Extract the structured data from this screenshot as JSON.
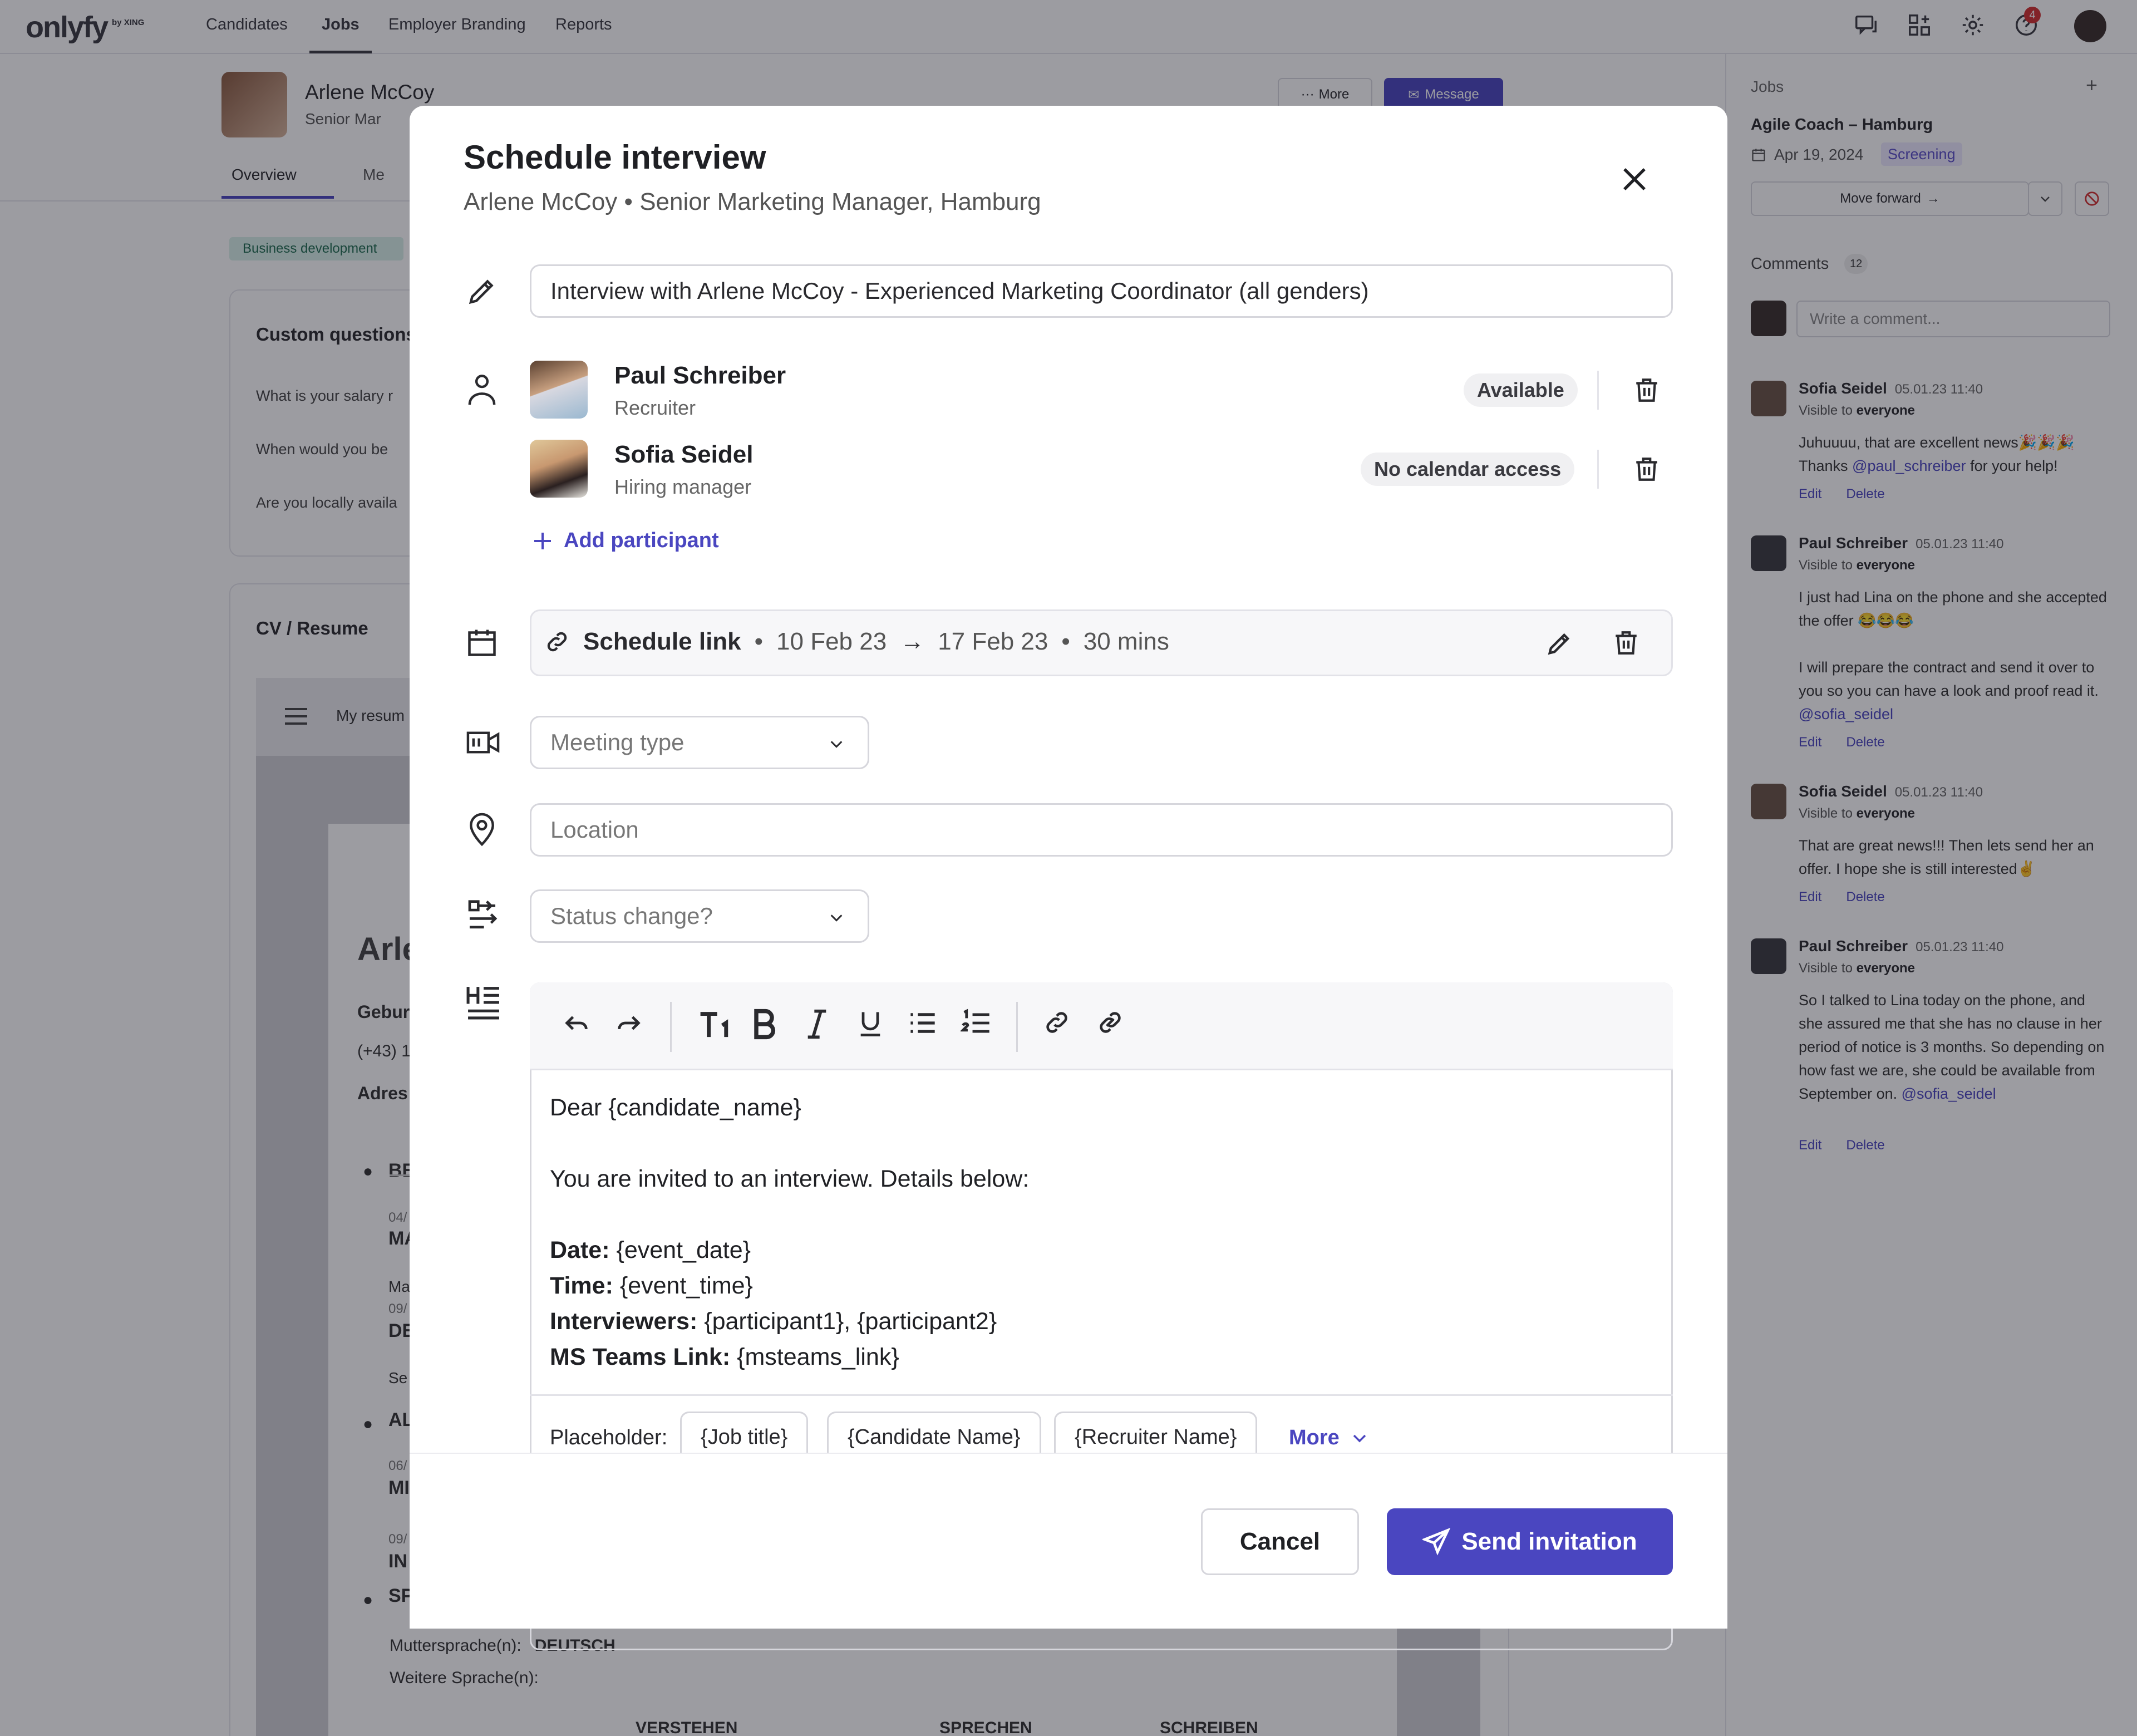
{
  "app": {
    "logo": "onlyfy",
    "logo_suffix": "by XING",
    "nav": [
      "Candidates",
      "Jobs",
      "Employer Branding",
      "Reports"
    ],
    "notifications_count": "4"
  },
  "candidate": {
    "name": "Arlene McCoy",
    "subtitle": "Senior Mar",
    "more_label": "More",
    "message_label": "Message",
    "tabs": [
      "Overview",
      "Me"
    ],
    "tag": "Business development",
    "custom_questions_title": "Custom questions",
    "custom_questions": [
      "What is your salary r",
      "When would you be",
      "Are you locally availa"
    ],
    "cv_title": "CV / Resume",
    "cv_toolbar_label": "My resum",
    "cv_text": {
      "name": "Arle",
      "l1": "Gebur",
      "l2": "(+43) 1",
      "l3": "Adres",
      "b1": "BE",
      "d1": "04/",
      "m1": "MA",
      "m2": "Ma",
      "d2": "09/",
      "de": "DE",
      "se": "Se",
      "al": "AL",
      "d3": "06/",
      "mi": "MI",
      "d4": "09/",
      "in": "IN",
      "sp": "SP",
      "mutter": "Muttersprache(n):",
      "mutter_val": "DEUTSCH",
      "weitere": "Weitere Sprache(n):",
      "cols": [
        "VERSTEHEN",
        "SPRECHEN",
        "SCHREIBEN"
      ]
    }
  },
  "right_panel": {
    "jobs_label": "Jobs",
    "job_title": "Agile Coach – Hamburg",
    "job_date": "Apr 19, 2024",
    "job_status": "Screening",
    "move_forward": "Move forward",
    "comments_label": "Comments",
    "comments_count": "12",
    "write_placeholder": "Write a comment...",
    "comments": [
      {
        "author": "Sofia Seidel",
        "time": "05.01.23 11:40",
        "visible_prefix": "Visible to",
        "visible_to": "everyone",
        "text_a": "Juhuuuu, that are excellent news🎉🎉🎉 Thanks ",
        "mention": "@paul_schreiber",
        "text_b": " for your help!",
        "edit": "Edit",
        "delete": "Delete"
      },
      {
        "author": "Paul Schreiber",
        "time": "05.01.23 11:40",
        "visible_prefix": "Visible to",
        "visible_to": "everyone",
        "text_a": "I just had Lina on the phone and she accepted the offer 😂😂😂\n\nI will prepare the contract and send it over to you so you can have a look and proof read it. ",
        "mention": "@sofia_seidel",
        "text_b": "",
        "edit": "Edit",
        "delete": "Delete"
      },
      {
        "author": "Sofia Seidel",
        "time": "05.01.23 11:40",
        "visible_prefix": "Visible to",
        "visible_to": "everyone",
        "text_a": "That are great news!!! Then lets send her an offer. I hope she is still interested✌️",
        "mention": "",
        "text_b": "",
        "edit": "Edit",
        "delete": "Delete"
      },
      {
        "author": "Paul Schreiber",
        "time": "05.01.23 11:40",
        "visible_prefix": "Visible to",
        "visible_to": "everyone",
        "text_a": "So I talked to Lina today on the phone, and she assured me that she has no clause in her period of notice is 3 months. So depending on how fast we are, she could be available from September on. ",
        "mention": "@sofia_seidel",
        "text_b": "",
        "edit": "Edit",
        "delete": "Delete"
      }
    ]
  },
  "modal": {
    "title": "Schedule interview",
    "subtitle_name": "Arlene McCoy",
    "subtitle_sep": "•",
    "subtitle_job": "Senior Marketing Manager, Hamburg",
    "subject_value": "Interview with Arlene McCoy - Experienced Marketing Coordinator (all genders)",
    "participants": [
      {
        "name": "Paul Schreiber",
        "role": "Recruiter",
        "availability": "Available"
      },
      {
        "name": "Sofia Seidel",
        "role": "Hiring manager",
        "availability": "No calendar access"
      }
    ],
    "add_participant": "Add participant",
    "schedule": {
      "label": "Schedule link",
      "sep": "•",
      "from": "10 Feb 23",
      "arrow": "→",
      "to": "17 Feb 23",
      "duration": "30 mins"
    },
    "meeting_type_placeholder": "Meeting type",
    "location_placeholder": "Location",
    "status_change_placeholder": "Status change?",
    "editor": {
      "greeting": "Dear {candidate_name}",
      "intro": "You are invited to an interview. Details below:",
      "date_label": "Date:",
      "date_value": " {event_date}",
      "time_label": "Time:",
      "time_value": " {event_time}",
      "interviewers_label": "Interviewers:",
      "interviewers_value": " {participant1}, {participant2}",
      "teams_label": "MS Teams Link:",
      "teams_value": " {msteams_link}"
    },
    "placeholder_label": "Placeholder:",
    "placeholders": [
      "{Job title}",
      "{Candidate Name}",
      "{Recruiter Name}"
    ],
    "placeholder_more": "More",
    "cancel": "Cancel",
    "send": "Send invitation",
    "colors": {
      "primary": "#4a46c0",
      "overlay": "rgba(20,20,30,0.42)"
    }
  }
}
